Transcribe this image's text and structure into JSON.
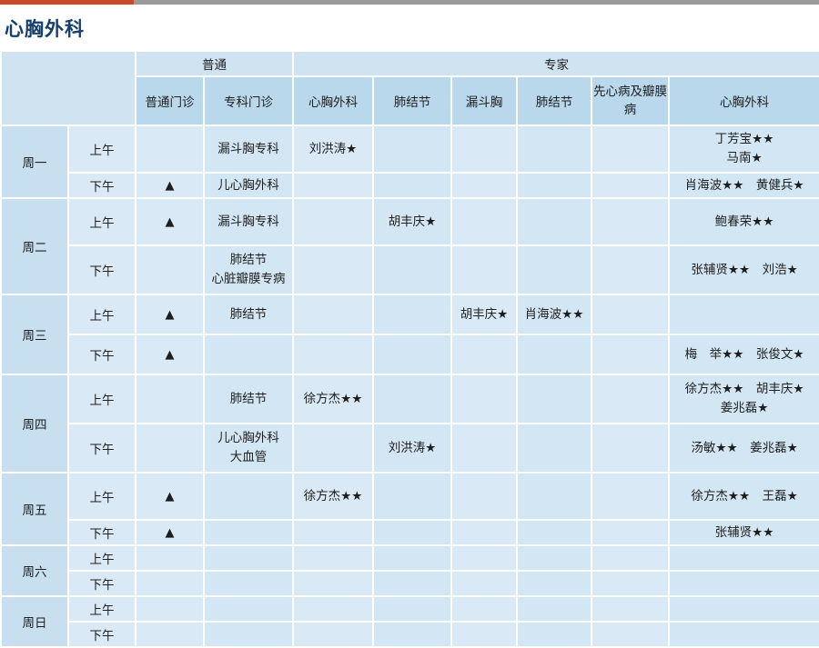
{
  "title": "心胸外科",
  "header": {
    "group_general": "普通",
    "group_expert": "专家",
    "columns": [
      "普通门诊",
      "专科门诊",
      "心胸外科",
      "肺结节",
      "漏斗胸",
      "肺结节",
      "先心病及瓣膜病",
      "心胸外科"
    ]
  },
  "am": "上午",
  "pm": "下午",
  "marker": "▲",
  "days": [
    {
      "day": "周一",
      "am": {
        "general": "",
        "special": "漏斗胸专科",
        "cardio": "刘洪涛★",
        "nodule1": "",
        "funnel": "",
        "nodule2": "",
        "congenital": "",
        "chief": "丁芳宝★★\n马南★"
      },
      "pm": {
        "general": "▲",
        "special": "儿心胸外科",
        "cardio": "",
        "nodule1": "",
        "funnel": "",
        "nodule2": "",
        "congenital": "",
        "chief": "肖海波★★　黄健兵★"
      }
    },
    {
      "day": "周二",
      "am": {
        "general": "▲",
        "special": "漏斗胸专科",
        "cardio": "",
        "nodule1": "胡丰庆★",
        "funnel": "",
        "nodule2": "",
        "congenital": "",
        "chief": "鲍春荣★★"
      },
      "pm": {
        "general": "",
        "special": "肺结节\n心脏瓣膜专病",
        "cardio": "",
        "nodule1": "",
        "funnel": "",
        "nodule2": "",
        "congenital": "",
        "chief": "张辅贤★★　刘浩★"
      }
    },
    {
      "day": "周三",
      "am": {
        "general": "▲",
        "special": "肺结节",
        "cardio": "",
        "nodule1": "",
        "funnel": "胡丰庆★",
        "nodule2": "肖海波★★",
        "congenital": "",
        "chief": ""
      },
      "pm": {
        "general": "▲",
        "special": "",
        "cardio": "",
        "nodule1": "",
        "funnel": "",
        "nodule2": "",
        "congenital": "",
        "chief": "梅　举★★　张俊文★"
      }
    },
    {
      "day": "周四",
      "am": {
        "general": "",
        "special": "肺结节",
        "cardio": "徐方杰★★",
        "nodule1": "",
        "funnel": "",
        "nodule2": "",
        "congenital": "",
        "chief": "徐方杰★★　胡丰庆★\n姜兆磊★"
      },
      "pm": {
        "general": "",
        "special": "儿心胸外科\n大血管",
        "cardio": "",
        "nodule1": "刘洪涛★",
        "funnel": "",
        "nodule2": "",
        "congenital": "",
        "chief": "汤敏★★　姜兆磊★"
      }
    },
    {
      "day": "周五",
      "am": {
        "general": "▲",
        "special": "",
        "cardio": "徐方杰★★",
        "nodule1": "",
        "funnel": "",
        "nodule2": "",
        "congenital": "",
        "chief": "徐方杰★★　王磊★"
      },
      "pm": {
        "general": "▲",
        "special": "",
        "cardio": "",
        "nodule1": "",
        "funnel": "",
        "nodule2": "",
        "congenital": "",
        "chief": "张辅贤★★"
      }
    },
    {
      "day": "周六",
      "am": {
        "general": "",
        "special": "",
        "cardio": "",
        "nodule1": "",
        "funnel": "",
        "nodule2": "",
        "congenital": "",
        "chief": ""
      },
      "pm": {
        "general": "",
        "special": "",
        "cardio": "",
        "nodule1": "",
        "funnel": "",
        "nodule2": "",
        "congenital": "",
        "chief": ""
      }
    },
    {
      "day": "周日",
      "am": {
        "general": "",
        "special": "",
        "cardio": "",
        "nodule1": "",
        "funnel": "",
        "nodule2": "",
        "congenital": "",
        "chief": ""
      },
      "pm": {
        "general": "",
        "special": "",
        "cardio": "",
        "nodule1": "",
        "funnel": "",
        "nodule2": "",
        "congenital": "",
        "chief": ""
      }
    }
  ]
}
